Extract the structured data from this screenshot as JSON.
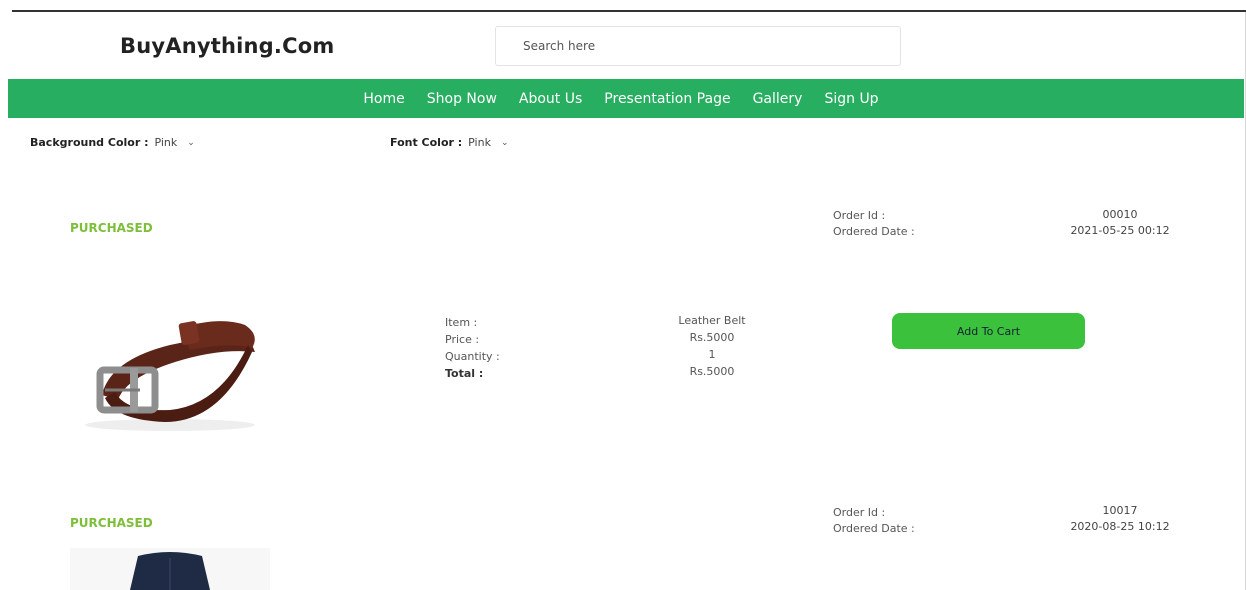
{
  "header": {
    "logo": "BuyAnything.Com",
    "search_placeholder": "Search here"
  },
  "nav": {
    "items": [
      {
        "label": "Home"
      },
      {
        "label": "Shop Now"
      },
      {
        "label": "About Us"
      },
      {
        "label": "Presentation Page"
      },
      {
        "label": "Gallery"
      },
      {
        "label": "Sign Up"
      }
    ],
    "color": "#27ae60"
  },
  "filters": {
    "background": {
      "label": "Background Color :",
      "value": "Pink"
    },
    "font": {
      "label": "Font Color :",
      "value": "Pink"
    }
  },
  "orders": [
    {
      "status": "PURCHASED",
      "order_id_label": "Order Id :",
      "ordered_date_label": "Ordered Date :",
      "order_id": "00010",
      "ordered_date": "2021-05-25 00:12",
      "image": "leather-belt-image",
      "item_label": "Item :",
      "price_label": "Price :",
      "quantity_label": "Quantity :",
      "total_label": "Total :",
      "item": "Leather Belt",
      "price": "Rs.5000",
      "quantity": "1",
      "total": "Rs.5000",
      "cart_label": "Add To Cart"
    },
    {
      "status": "PURCHASED",
      "order_id_label": "Order Id :",
      "ordered_date_label": "Ordered Date :",
      "order_id": "10017",
      "ordered_date": "2020-08-25 10:12",
      "image": "trousers-image"
    }
  ],
  "colors": {
    "status": "#7dbf3a",
    "button": "#3cc13c",
    "nav": "#27ae60"
  }
}
